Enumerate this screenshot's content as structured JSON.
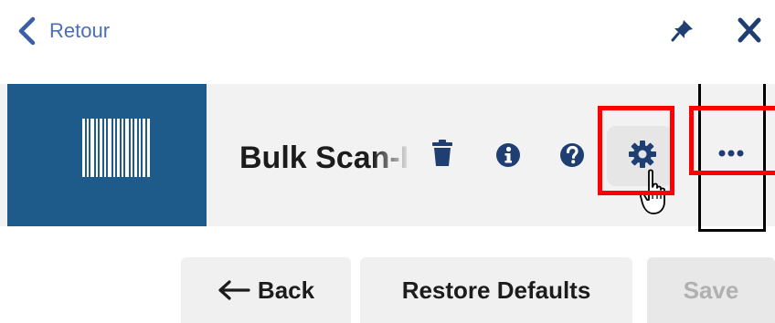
{
  "topbar": {
    "back_label": "Retour",
    "icons": [
      "chevron-left-icon",
      "pin-icon",
      "close-icon"
    ]
  },
  "header": {
    "title": "Bulk Scan-I",
    "icons": [
      "barcode-icon",
      "trash-icon",
      "info-icon",
      "help-icon",
      "gear-icon",
      "more-icon"
    ]
  },
  "footer": {
    "back_label": "Back",
    "restore_label": "Restore Defaults",
    "save_label": "Save"
  },
  "colors": {
    "accent": "#4a6fb5",
    "thumbnail_bg": "#1f5b8a",
    "icon_color": "#1f3f73",
    "highlight": "#ff0000"
  }
}
